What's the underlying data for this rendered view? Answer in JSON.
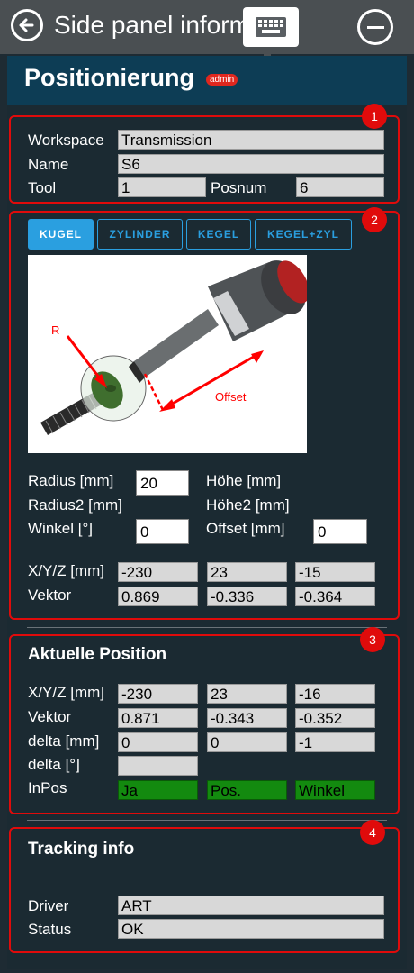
{
  "window": {
    "title": "Side panel information"
  },
  "header": {
    "title": "Positionierung",
    "badge": "admin"
  },
  "section_numbers": [
    "1",
    "2",
    "3",
    "4"
  ],
  "section1": {
    "workspace_label": "Workspace",
    "workspace_value": "Transmission",
    "name_label": "Name",
    "name_value": "S6",
    "tool_label": "Tool",
    "tool_value": "1",
    "posnum_label": "Posnum",
    "posnum_value": "6"
  },
  "section2": {
    "tabs": [
      "KUGEL",
      "ZYLINDER",
      "KEGEL",
      "KEGEL+ZYL"
    ],
    "active_tab": "KUGEL",
    "illustration": {
      "label_r": "R",
      "label_offset": "Offset"
    },
    "radius_label": "Radius [mm]",
    "radius_value": "20",
    "radius2_label": "Radius2 [mm]",
    "winkel_label": "Winkel [°]",
    "winkel_value": "0",
    "hoehe_label": "Höhe [mm]",
    "hoehe2_label": "Höhe2 [mm]",
    "offset_label": "Offset [mm]",
    "offset_value": "0",
    "xyz_label": "X/Y/Z [mm]",
    "xyz": [
      "-230",
      "23",
      "-15"
    ],
    "vektor_label": "Vektor",
    "vektor": [
      "0.869",
      "-0.336",
      "-0.364"
    ]
  },
  "section3": {
    "title": "Aktuelle Position",
    "xyz_label": "X/Y/Z [mm]",
    "xyz": [
      "-230",
      "23",
      "-16"
    ],
    "vektor_label": "Vektor",
    "vektor": [
      "0.871",
      "-0.343",
      "-0.352"
    ],
    "delta_mm_label": "delta [mm]",
    "delta_mm": [
      "0",
      "0",
      "-1"
    ],
    "delta_deg_label": "delta [°]",
    "delta_deg": "",
    "inpos_label": "InPos",
    "inpos": [
      "Ja",
      "Pos.",
      "Winkel"
    ],
    "status_color": "#138a0f"
  },
  "section4": {
    "title": "Tracking info",
    "driver_label": "Driver",
    "driver_value": "ART",
    "status_label": "Status",
    "status_value": "OK"
  },
  "colors": {
    "accent": "#2a9fe0",
    "section_border": "#e00b0b",
    "header_bg": "#0d3d55"
  },
  "icons": {
    "back": "back-arrow-icon",
    "keyboard": "keyboard-icon",
    "minimize": "minus-circle-icon"
  }
}
